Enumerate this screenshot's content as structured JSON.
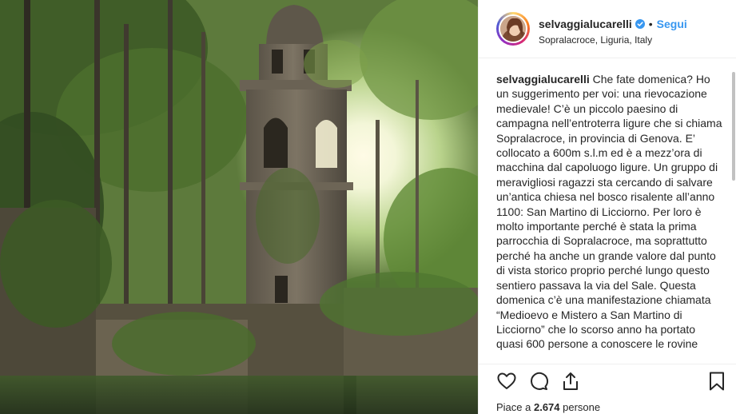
{
  "post": {
    "username": "selvaggialucarelli",
    "follow_label": "Segui",
    "separator": "•",
    "location": "Sopralacroce, Liguria, Italy",
    "caption_user": "selvaggialucarelli",
    "caption_text": " Che fate domenica? Ho un suggerimento per voi: una rievocazione medievale! C’è un piccolo paesino di campagna nell’entroterra ligure che si chiama Sopralacroce, in provincia di Genova. E’ collocato a 600m s.l.m ed è a mezz’ora di macchina dal capoluogo ligure. Un gruppo di meravigliosi ragazzi sta cercando di salvare un’antica chiesa nel bosco risalente all’anno 1100: San Martino di Licciorno. Per loro è molto importante perché è stata la prima parrocchia di Sopralacroce, ma soprattutto perché ha anche un grande valore dal punto di vista storico proprio perché lungo questo sentiero passava la via del Sale. Questa domenica c’è una manifestazione chiamata “Medioevo e Mistero a San Martino di Licciorno” che lo scorso anno ha portato quasi 600 persone a conoscere le rovine",
    "likes_prefix": "Piace a ",
    "likes_count": "2.674",
    "likes_suffix": " persone"
  },
  "icons": {
    "verified": "verified-badge-icon",
    "like": "heart-icon",
    "comment": "comment-icon",
    "share": "share-icon",
    "save": "bookmark-icon"
  },
  "colors": {
    "link": "#3897f0",
    "text": "#262626",
    "border": "#efefef"
  }
}
